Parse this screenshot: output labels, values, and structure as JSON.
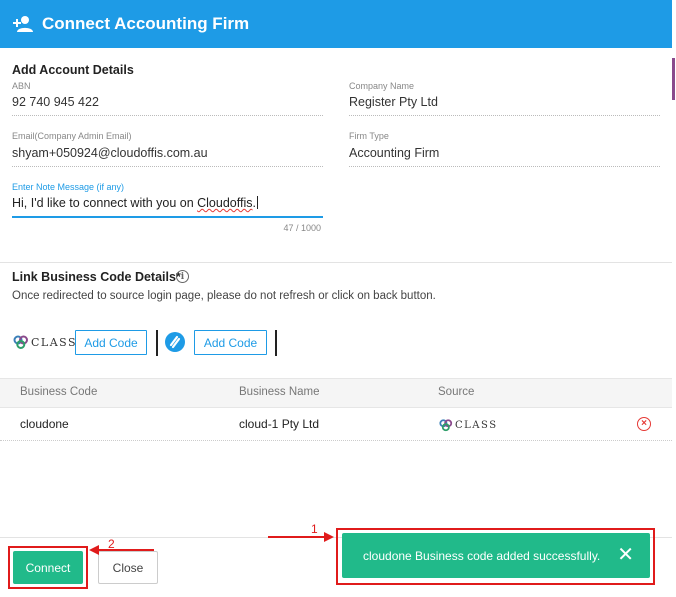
{
  "header": {
    "title": "Connect Accounting Firm",
    "icon": "person-add-icon"
  },
  "account": {
    "section_title": "Add Account Details",
    "abn_label": "ABN",
    "abn_value": "92 740 945 422",
    "company_label": "Company Name",
    "company_value": "Register Pty Ltd",
    "email_label": "Email(Company Admin Email)",
    "email_value": "shyam+050924@cloudoffis.com.au",
    "firm_type_label": "Firm Type",
    "firm_type_value": "Accounting Firm",
    "note_label": "Enter Note Message (if any)",
    "note_prefix": "Hi, I'd like to connect with you on ",
    "note_spell": "Cloudoffis",
    "note_suffix": ".",
    "note_counter": "47 / 1000"
  },
  "link": {
    "section_title": "Link Business Code Details*",
    "hint": "Once redirected to source login page, please do not refresh or click on back button.",
    "class_logo_text": "CLASS",
    "add_code_1": "Add Code",
    "add_code_2": "Add Code"
  },
  "table": {
    "headers": [
      "Business Code",
      "Business Name",
      "Source"
    ],
    "rows": [
      {
        "code": "cloudone",
        "name": "cloud-1 Pty Ltd",
        "source_logo": "CLASS"
      }
    ]
  },
  "footer": {
    "connect_label": "Connect",
    "close_label": "Close"
  },
  "toast": {
    "message": "cloudone Business code added successfully."
  },
  "annotations": {
    "label_1": "1",
    "label_2": "2"
  },
  "colors": {
    "accent": "#1e9be6",
    "success": "#21ba8a",
    "annotation": "#e01b1b",
    "danger": "#e53935"
  }
}
